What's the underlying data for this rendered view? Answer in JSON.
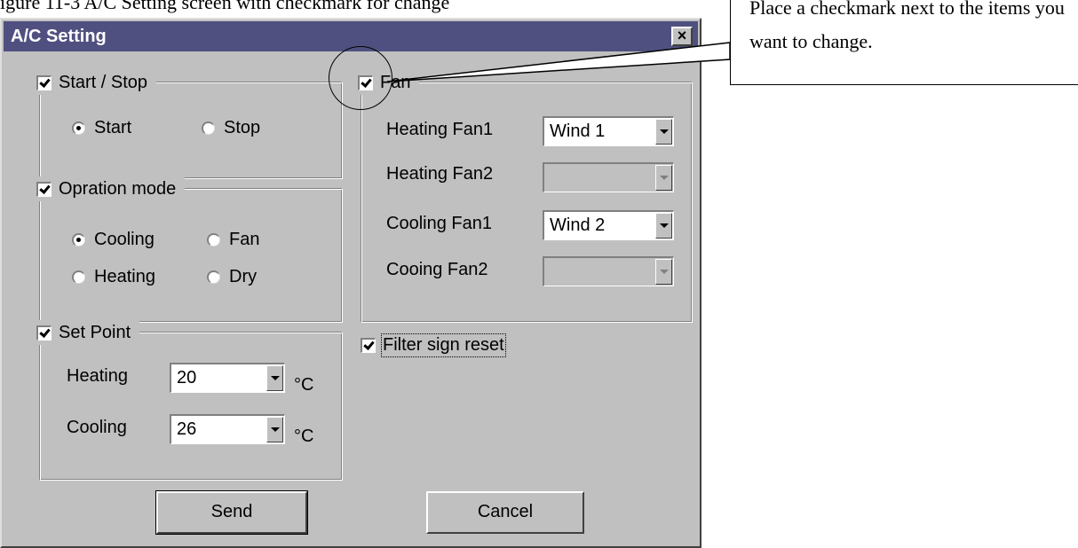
{
  "doc": {
    "top_text": "igure 11-3 A/C Setting screen with checkmark for change"
  },
  "window": {
    "title": "A/C Setting",
    "close_label": "×"
  },
  "start_stop": {
    "label": "Start / Stop",
    "checked": true,
    "options": [
      "Start",
      "Stop"
    ],
    "selected": "Start"
  },
  "operation_mode": {
    "label": "Opration mode",
    "checked": true,
    "options": [
      "Cooling",
      "Fan",
      "Heating",
      "Dry"
    ],
    "selected": "Cooling"
  },
  "set_point": {
    "label": "Set Point",
    "checked": true,
    "heating_label": "Heating",
    "heating_value": "20",
    "cooling_label": "Cooling",
    "cooling_value": "26",
    "unit": "°C"
  },
  "fan": {
    "label": "Fan",
    "checked": true,
    "rows": [
      {
        "label": "Heating Fan1",
        "value": "Wind 1",
        "enabled": true
      },
      {
        "label": "Heating Fan2",
        "value": "",
        "enabled": false
      },
      {
        "label": "Cooling Fan1",
        "value": "Wind 2",
        "enabled": true
      },
      {
        "label": "Cooing Fan2",
        "value": "",
        "enabled": false
      }
    ]
  },
  "filter": {
    "label": "Filter sign reset",
    "checked": true
  },
  "buttons": {
    "send": "Send",
    "cancel": "Cancel"
  },
  "callout": {
    "text": "Place a checkmark next to the items you want to change."
  }
}
